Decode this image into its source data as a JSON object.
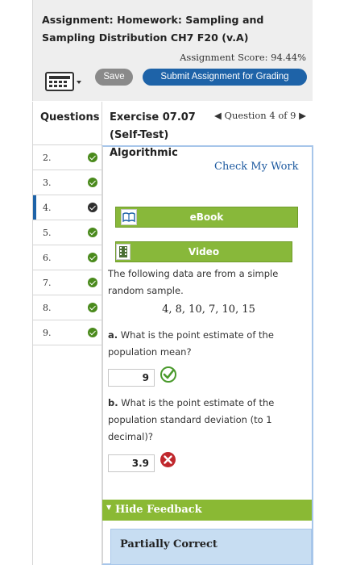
{
  "header": {
    "title": "Assignment: Homework: Sampling and Sampling Distribution CH7 F20 (v.A)",
    "assignment_score": "Assignment Score: 94.44%",
    "save_label": "Save",
    "submit_label": "Submit Assignment for Grading",
    "calculator_icon": "calculator-icon"
  },
  "sidebar": {
    "heading": "Questions",
    "items": [
      {
        "label": "2.",
        "status": "correct"
      },
      {
        "label": "3.",
        "status": "correct"
      },
      {
        "label": "4.",
        "status": "partial",
        "active": true
      },
      {
        "label": "5.",
        "status": "correct"
      },
      {
        "label": "6.",
        "status": "correct"
      },
      {
        "label": "7.",
        "status": "correct"
      },
      {
        "label": "8.",
        "status": "correct"
      },
      {
        "label": "9.",
        "status": "correct"
      }
    ]
  },
  "exercise": {
    "title": "Exercise 07.07 (Self-Test) Algorithmic",
    "question_nav": "Question 4 of 9",
    "check_my_work": "Check My Work",
    "ebook_label": "eBook",
    "video_label": "Video",
    "intro": "The following data are from a simple random sample.",
    "data_values": "4, 8, 10, 7, 10, 15",
    "part_a_label": "a.",
    "part_a_text": "What is the point estimate of the population mean?",
    "part_a_answer": "9",
    "part_b_label": "b.",
    "part_b_text": "What is the point estimate of the population standard deviation (to 1 decimal)?",
    "part_b_answer": "3.9"
  },
  "feedback": {
    "toggle_label": "Hide Feedback",
    "status": "Partially Correct"
  },
  "colors": {
    "accent_blue": "#1e63a8",
    "correct_green": "#4a8a1c",
    "feedback_green": "#8ab934",
    "error_red": "#c0282d"
  }
}
